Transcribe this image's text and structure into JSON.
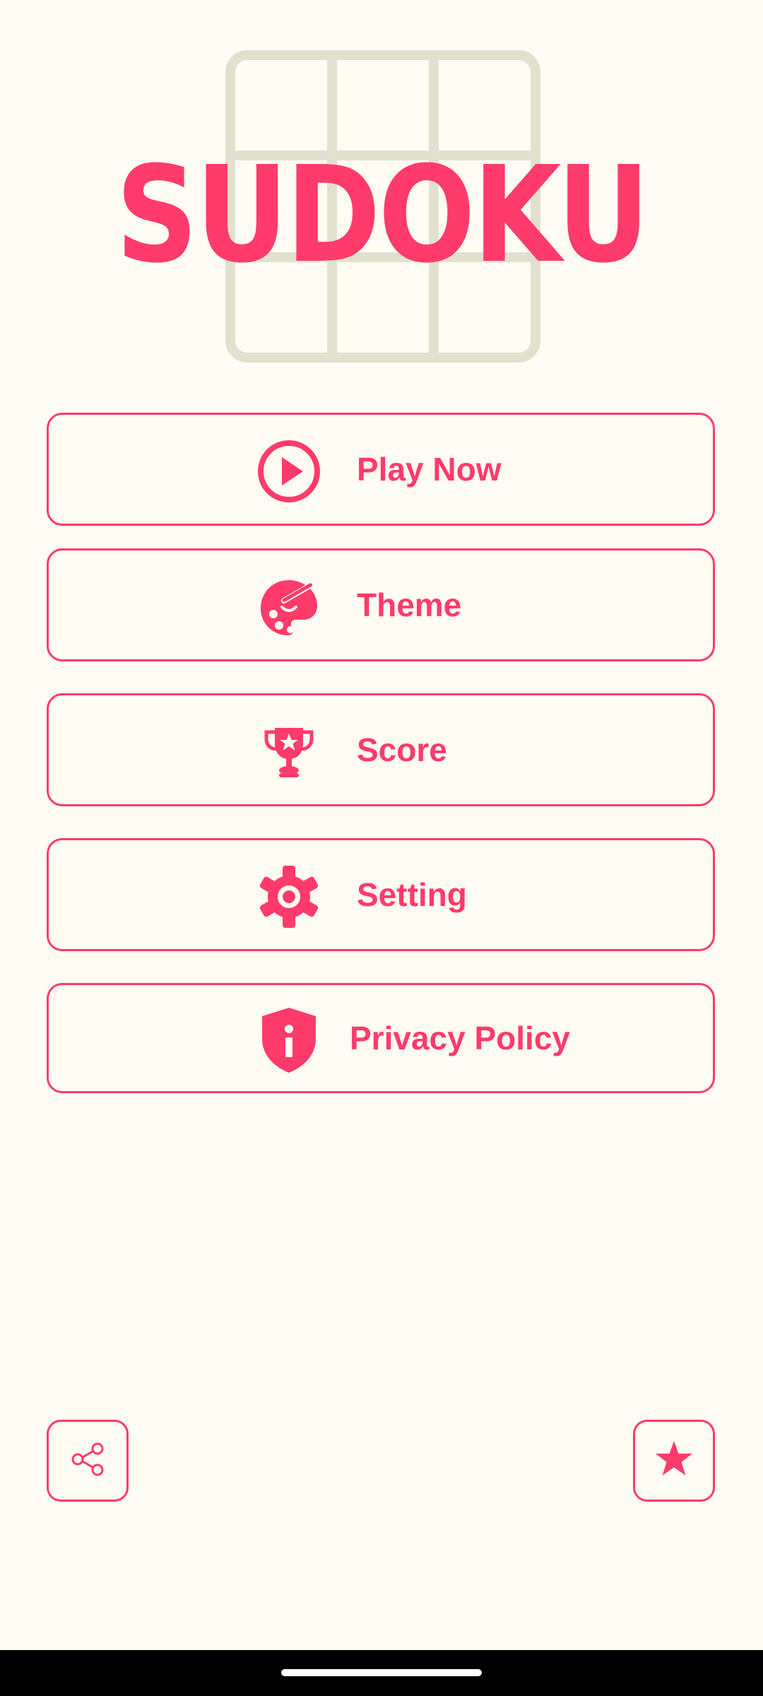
{
  "app": {
    "title": "SUDOKU"
  },
  "menu": [
    {
      "label": "Play Now",
      "icon": "play-circle-icon"
    },
    {
      "label": "Theme",
      "icon": "palette-icon"
    },
    {
      "label": "Score",
      "icon": "trophy-icon"
    },
    {
      "label": "Setting",
      "icon": "gear-icon"
    },
    {
      "label": "Privacy Policy",
      "icon": "shield-info-icon"
    }
  ],
  "bottom_actions": {
    "share_icon": "share-icon",
    "rate_icon": "star-icon"
  },
  "colors": {
    "accent": "#ff3b6b",
    "background": "#fffcf4",
    "grid": "#e2e1cd"
  }
}
